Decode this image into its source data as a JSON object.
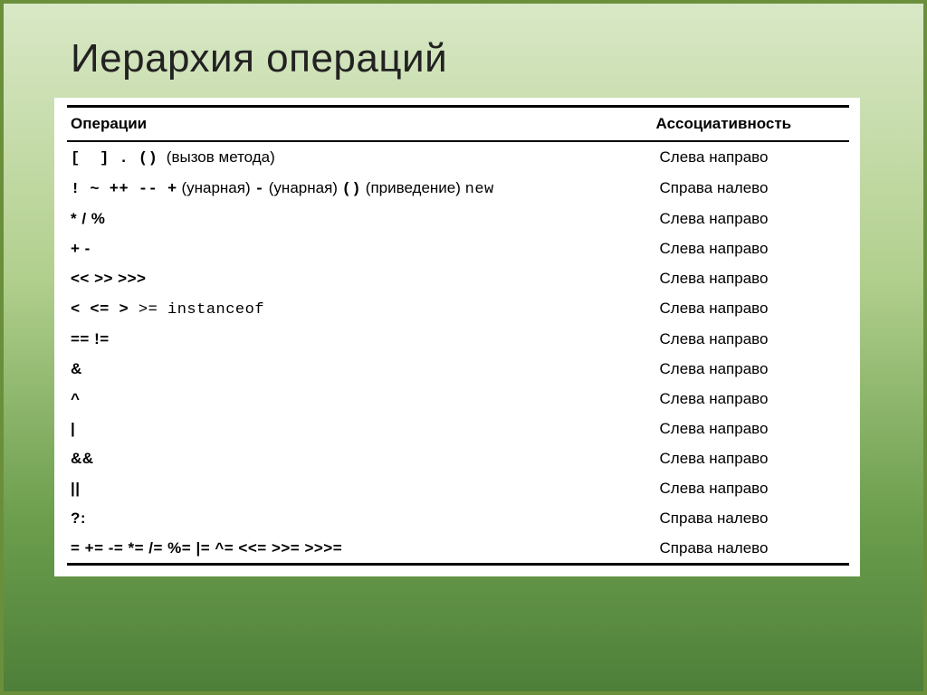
{
  "slide": {
    "title": "Иерархия операций"
  },
  "table": {
    "header_ops": "Операции",
    "header_assoc": "Ассоциативность",
    "rows": [
      {
        "ops": "[ ] . () (вызов метода)",
        "assoc": "Слева направо"
      },
      {
        "ops": "! ~ ++ -- + (унарная) - (унарная) () (приведение) new",
        "assoc": "Справа налево"
      },
      {
        "ops": "* / %",
        "assoc": "Слева направо"
      },
      {
        "ops": "+ -",
        "assoc": "Слева направо"
      },
      {
        "ops": "<< >> >>>",
        "assoc": "Слева направо"
      },
      {
        "ops": "< <= > >= instanceof",
        "assoc": "Слева направо"
      },
      {
        "ops": "== !=",
        "assoc": "Слева направо"
      },
      {
        "ops": "&",
        "assoc": "Слева направо"
      },
      {
        "ops": "^",
        "assoc": "Слева направо"
      },
      {
        "ops": "|",
        "assoc": "Слева направо"
      },
      {
        "ops": "&&",
        "assoc": "Слева направо"
      },
      {
        "ops": "||",
        "assoc": "Слева направо"
      },
      {
        "ops": "?:",
        "assoc": "Справа налево"
      },
      {
        "ops": "= += -= *= /= %= |= ^= <<= >>= >>>=",
        "assoc": "Справа налево"
      }
    ]
  }
}
